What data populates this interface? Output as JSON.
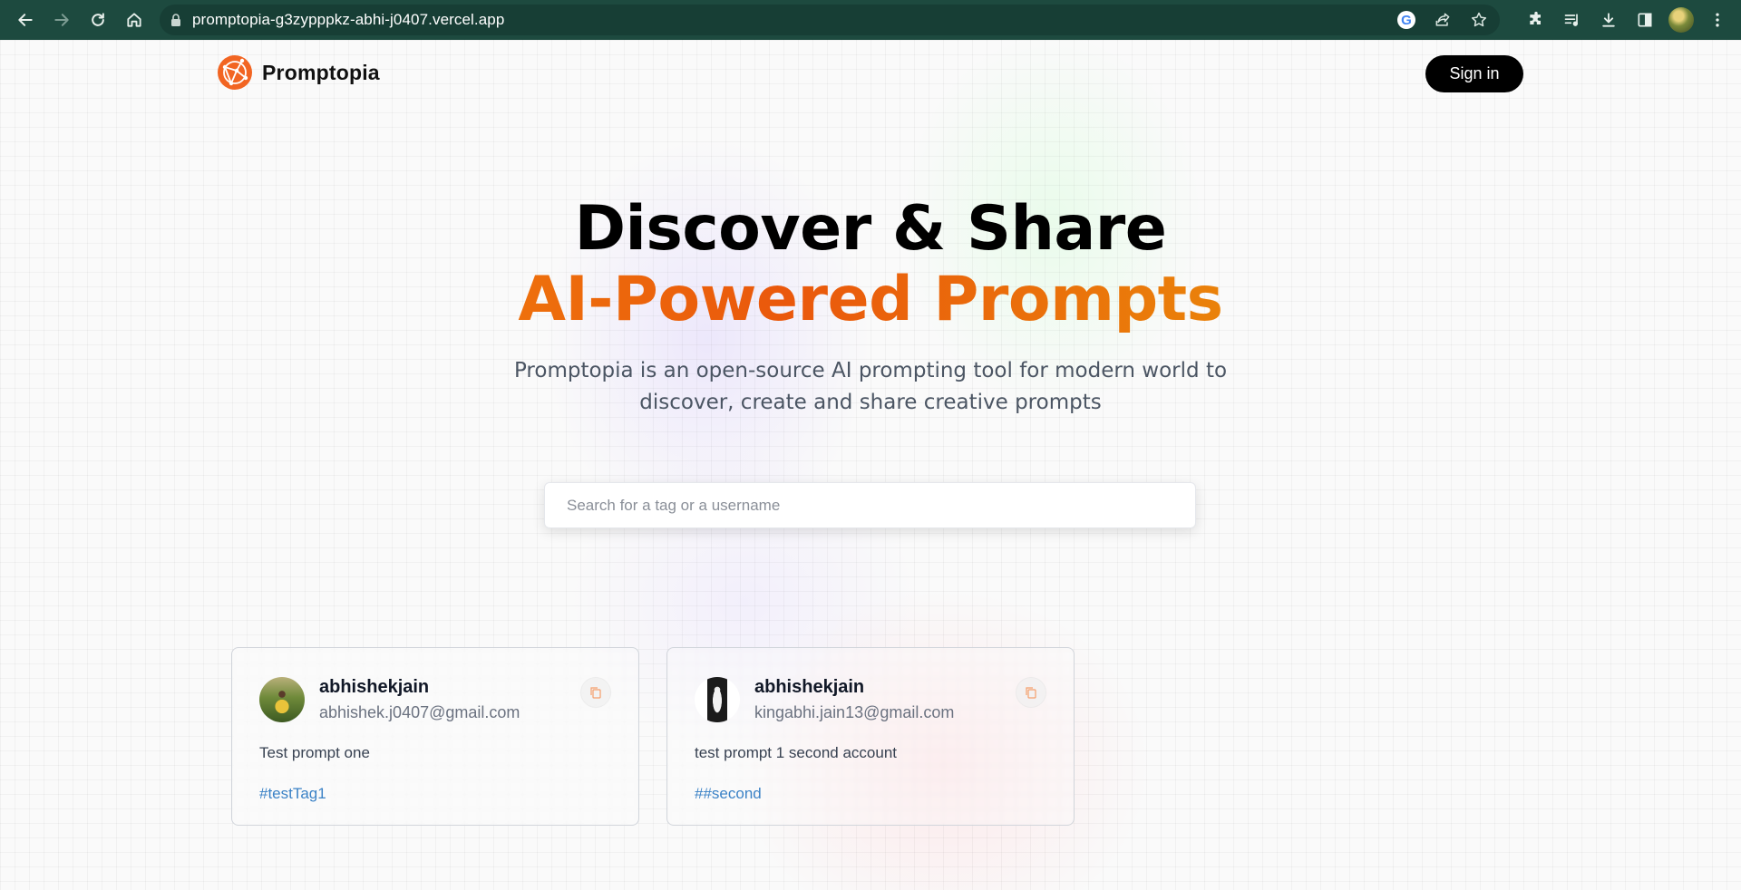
{
  "browser": {
    "url": "promptopia-g3zypppkz-abhi-j0407.vercel.app",
    "icons": [
      "back-icon",
      "forward-icon",
      "reload-icon",
      "home-icon",
      "lock-icon",
      "google-lens-icon",
      "share-icon",
      "bookmark-star-icon",
      "extensions-icon",
      "media-icon",
      "download-icon",
      "side-panel-icon",
      "profile-avatar",
      "menu-icon"
    ]
  },
  "nav": {
    "brand": "Promptopia",
    "sign_in": "Sign in"
  },
  "hero": {
    "title_line1": "Discover & Share",
    "title_line2": "AI-Powered Prompts",
    "description": "Promptopia is an open-source AI prompting tool for modern world to discover, create and share creative prompts"
  },
  "search": {
    "placeholder": "Search for a tag or a username"
  },
  "prompts": [
    {
      "username": "abhishekjain",
      "email": "abhishek.j0407@gmail.com",
      "prompt": "Test prompt one",
      "tag": "#testTag1"
    },
    {
      "username": "abhishekjain",
      "email": "kingabhi.jain13@gmail.com",
      "prompt": "test prompt 1 second account",
      "tag": "##second"
    }
  ],
  "colors": {
    "chrome_bg": "#1d4a3f",
    "brand_orange": "#f26522",
    "gradient": [
      "#f59e0b",
      "#ea580c",
      "#eab308"
    ],
    "tag_blue": "#3b82c6"
  }
}
